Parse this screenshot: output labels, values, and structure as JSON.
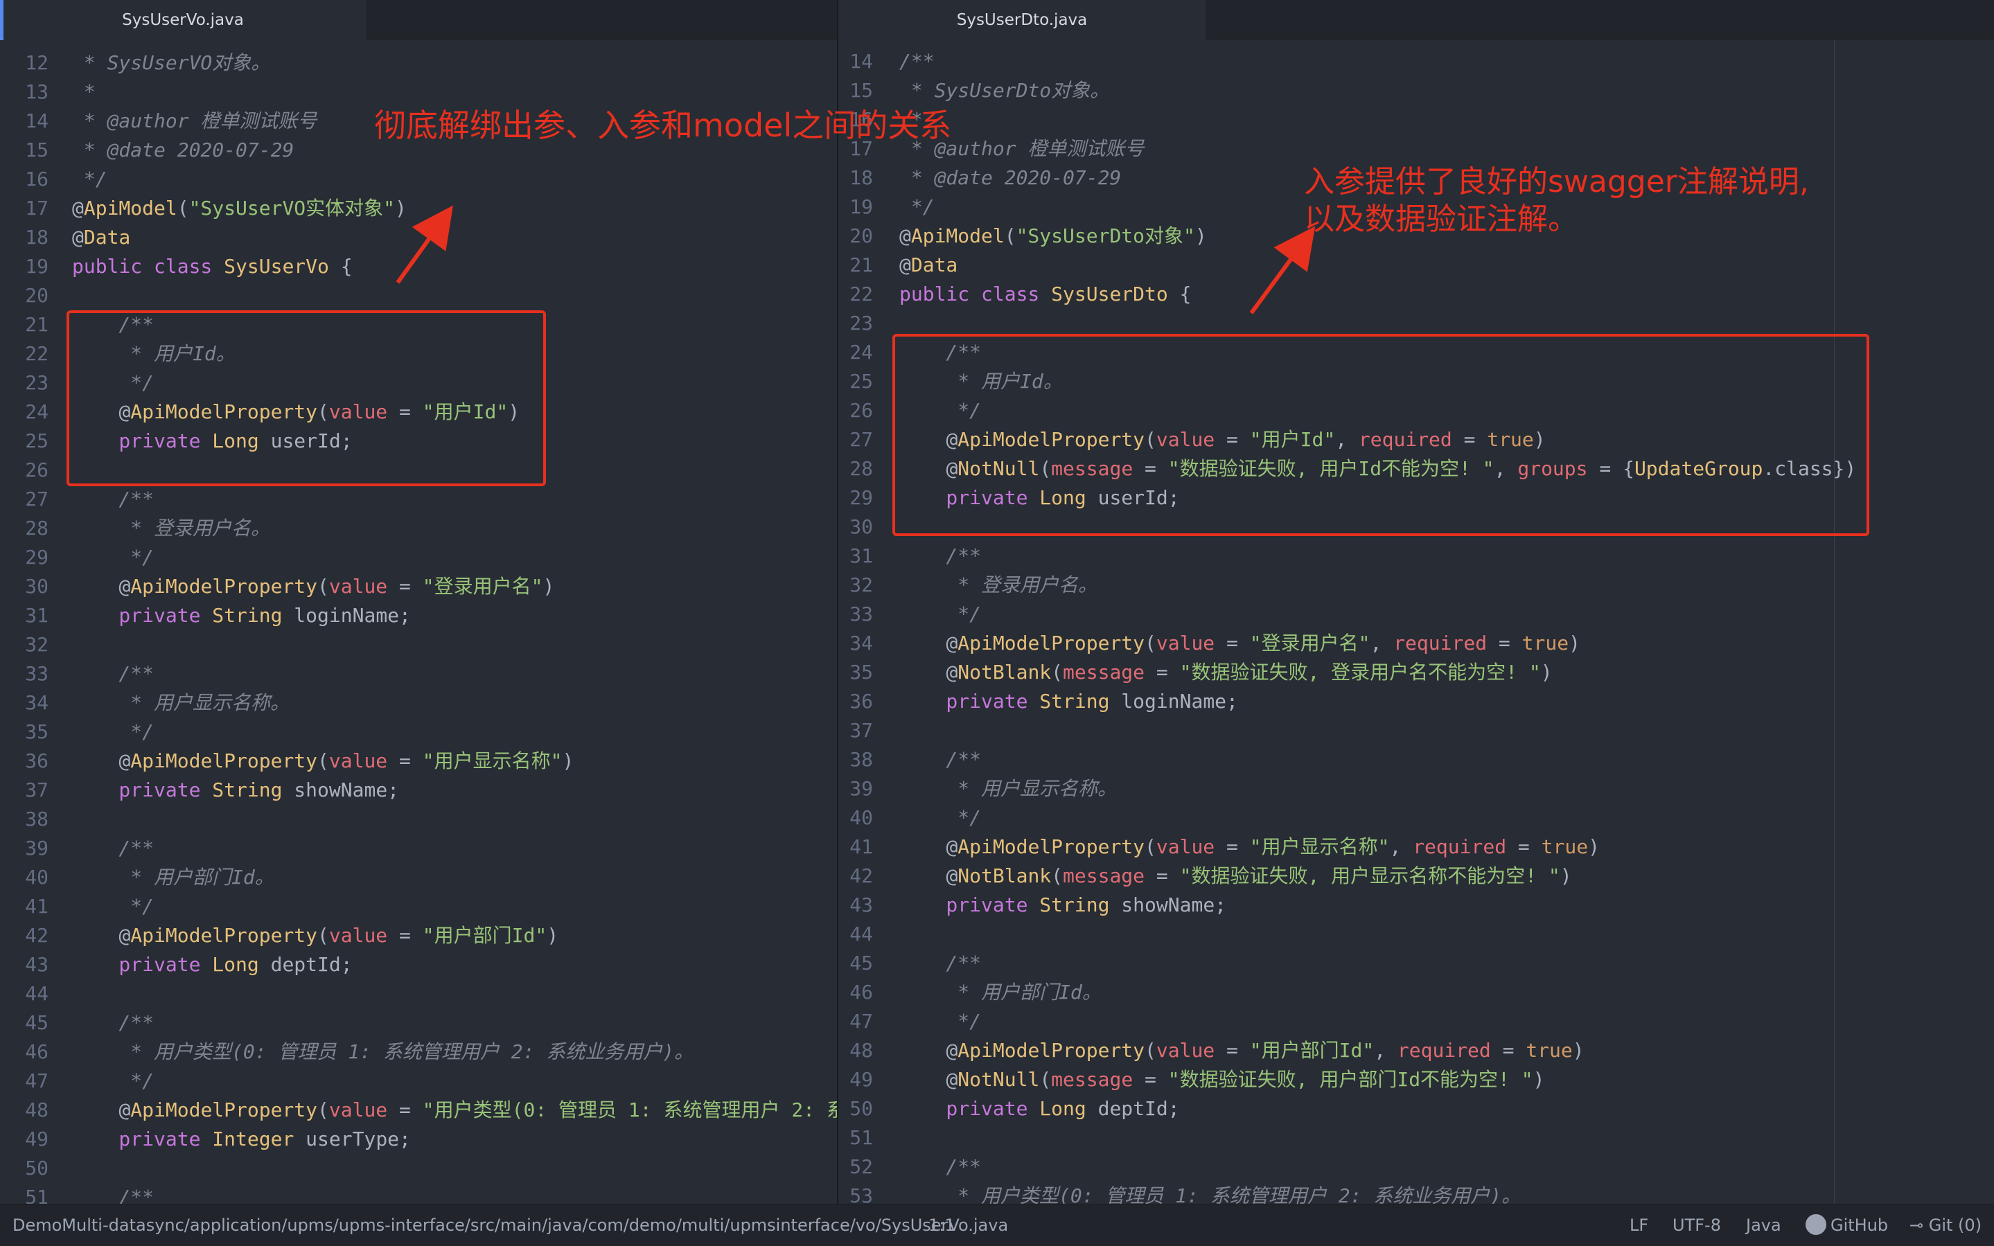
{
  "tabs": {
    "left": "SysUserVo.java",
    "right": "SysUserDto.java"
  },
  "annotations": {
    "left": "彻底解绑出参、入参和model之间的关系",
    "right_line1": "入参提供了良好的swagger注解说明,",
    "right_line2": "以及数据验证注解。"
  },
  "left_code": [
    {
      "n": "12",
      "t": [
        [
          "c",
          " * SysUserVO对象。"
        ]
      ]
    },
    {
      "n": "13",
      "t": [
        [
          "c",
          " *"
        ]
      ]
    },
    {
      "n": "14",
      "t": [
        [
          "c",
          " * @author 橙单测试账号"
        ]
      ]
    },
    {
      "n": "15",
      "t": [
        [
          "c",
          " * @date 2020-07-29"
        ]
      ]
    },
    {
      "n": "16",
      "t": [
        [
          "c",
          " */"
        ]
      ]
    },
    {
      "n": "17",
      "t": [
        [
          "at",
          "@"
        ],
        [
          "an",
          "ApiModel"
        ],
        [
          "txt",
          "("
        ],
        [
          "st",
          "\"SysUserVO实体对象\""
        ],
        [
          "txt",
          ")"
        ]
      ]
    },
    {
      "n": "18",
      "t": [
        [
          "at",
          "@"
        ],
        [
          "an",
          "Data"
        ]
      ]
    },
    {
      "n": "19",
      "t": [
        [
          "kw",
          "public class "
        ],
        [
          "ty",
          "SysUserVo"
        ],
        [
          "txt",
          " {"
        ]
      ]
    },
    {
      "n": "20",
      "t": []
    },
    {
      "n": "21",
      "t": [
        [
          "c",
          "    /**"
        ]
      ]
    },
    {
      "n": "22",
      "t": [
        [
          "c",
          "     * 用户Id。"
        ]
      ]
    },
    {
      "n": "23",
      "t": [
        [
          "c",
          "     */"
        ]
      ]
    },
    {
      "n": "24",
      "t": [
        [
          "txt",
          "    "
        ],
        [
          "at",
          "@"
        ],
        [
          "an",
          "ApiModelProperty"
        ],
        [
          "txt",
          "("
        ],
        [
          "pr",
          "value"
        ],
        [
          "txt",
          " = "
        ],
        [
          "st",
          "\"用户Id\""
        ],
        [
          "txt",
          ")"
        ]
      ]
    },
    {
      "n": "25",
      "t": [
        [
          "kw",
          "    private "
        ],
        [
          "ty",
          "Long"
        ],
        [
          "txt",
          " userId;"
        ]
      ]
    },
    {
      "n": "26",
      "t": []
    },
    {
      "n": "27",
      "t": [
        [
          "c",
          "    /**"
        ]
      ]
    },
    {
      "n": "28",
      "t": [
        [
          "c",
          "     * 登录用户名。"
        ]
      ]
    },
    {
      "n": "29",
      "t": [
        [
          "c",
          "     */"
        ]
      ]
    },
    {
      "n": "30",
      "t": [
        [
          "txt",
          "    "
        ],
        [
          "at",
          "@"
        ],
        [
          "an",
          "ApiModelProperty"
        ],
        [
          "txt",
          "("
        ],
        [
          "pr",
          "value"
        ],
        [
          "txt",
          " = "
        ],
        [
          "st",
          "\"登录用户名\""
        ],
        [
          "txt",
          ")"
        ]
      ]
    },
    {
      "n": "31",
      "t": [
        [
          "kw",
          "    private "
        ],
        [
          "ty",
          "String"
        ],
        [
          "txt",
          " loginName;"
        ]
      ]
    },
    {
      "n": "32",
      "t": []
    },
    {
      "n": "33",
      "t": [
        [
          "c",
          "    /**"
        ]
      ]
    },
    {
      "n": "34",
      "t": [
        [
          "c",
          "     * 用户显示名称。"
        ]
      ]
    },
    {
      "n": "35",
      "t": [
        [
          "c",
          "     */"
        ]
      ]
    },
    {
      "n": "36",
      "t": [
        [
          "txt",
          "    "
        ],
        [
          "at",
          "@"
        ],
        [
          "an",
          "ApiModelProperty"
        ],
        [
          "txt",
          "("
        ],
        [
          "pr",
          "value"
        ],
        [
          "txt",
          " = "
        ],
        [
          "st",
          "\"用户显示名称\""
        ],
        [
          "txt",
          ")"
        ]
      ]
    },
    {
      "n": "37",
      "t": [
        [
          "kw",
          "    private "
        ],
        [
          "ty",
          "String"
        ],
        [
          "txt",
          " showName;"
        ]
      ]
    },
    {
      "n": "38",
      "t": []
    },
    {
      "n": "39",
      "t": [
        [
          "c",
          "    /**"
        ]
      ]
    },
    {
      "n": "40",
      "t": [
        [
          "c",
          "     * 用户部门Id。"
        ]
      ]
    },
    {
      "n": "41",
      "t": [
        [
          "c",
          "     */"
        ]
      ]
    },
    {
      "n": "42",
      "t": [
        [
          "txt",
          "    "
        ],
        [
          "at",
          "@"
        ],
        [
          "an",
          "ApiModelProperty"
        ],
        [
          "txt",
          "("
        ],
        [
          "pr",
          "value"
        ],
        [
          "txt",
          " = "
        ],
        [
          "st",
          "\"用户部门Id\""
        ],
        [
          "txt",
          ")"
        ]
      ]
    },
    {
      "n": "43",
      "t": [
        [
          "kw",
          "    private "
        ],
        [
          "ty",
          "Long"
        ],
        [
          "txt",
          " deptId;"
        ]
      ]
    },
    {
      "n": "44",
      "t": []
    },
    {
      "n": "45",
      "t": [
        [
          "c",
          "    /**"
        ]
      ]
    },
    {
      "n": "46",
      "t": [
        [
          "c",
          "     * 用户类型(0: 管理员 1: 系统管理用户 2: 系统业务用户)。"
        ]
      ]
    },
    {
      "n": "47",
      "t": [
        [
          "c",
          "     */"
        ]
      ]
    },
    {
      "n": "48",
      "t": [
        [
          "txt",
          "    "
        ],
        [
          "at",
          "@"
        ],
        [
          "an",
          "ApiModelProperty"
        ],
        [
          "txt",
          "("
        ],
        [
          "pr",
          "value"
        ],
        [
          "txt",
          " = "
        ],
        [
          "st",
          "\"用户类型(0: 管理员 1: 系统管理用户 2: 系"
        ]
      ]
    },
    {
      "n": "49",
      "t": [
        [
          "kw",
          "    private "
        ],
        [
          "ty",
          "Integer"
        ],
        [
          "txt",
          " userType;"
        ]
      ]
    },
    {
      "n": "50",
      "t": []
    },
    {
      "n": "51",
      "t": [
        [
          "c",
          "    /**"
        ]
      ]
    }
  ],
  "right_code": [
    {
      "n": "14",
      "t": [
        [
          "c",
          "/**"
        ]
      ]
    },
    {
      "n": "15",
      "t": [
        [
          "c",
          " * SysUserDto对象。"
        ]
      ]
    },
    {
      "n": "16",
      "t": [
        [
          "c",
          " *"
        ]
      ]
    },
    {
      "n": "17",
      "t": [
        [
          "c",
          " * @author 橙单测试账号"
        ]
      ]
    },
    {
      "n": "18",
      "t": [
        [
          "c",
          " * @date 2020-07-29"
        ]
      ]
    },
    {
      "n": "19",
      "t": [
        [
          "c",
          " */"
        ]
      ]
    },
    {
      "n": "20",
      "t": [
        [
          "at",
          "@"
        ],
        [
          "an",
          "ApiModel"
        ],
        [
          "txt",
          "("
        ],
        [
          "st",
          "\"SysUserDto对象\""
        ],
        [
          "txt",
          ")"
        ]
      ]
    },
    {
      "n": "21",
      "t": [
        [
          "at",
          "@"
        ],
        [
          "an",
          "Data"
        ]
      ]
    },
    {
      "n": "22",
      "t": [
        [
          "kw",
          "public class "
        ],
        [
          "ty",
          "SysUserDto"
        ],
        [
          "txt",
          " {"
        ]
      ]
    },
    {
      "n": "23",
      "t": []
    },
    {
      "n": "24",
      "t": [
        [
          "c",
          "    /**"
        ]
      ]
    },
    {
      "n": "25",
      "t": [
        [
          "c",
          "     * 用户Id。"
        ]
      ]
    },
    {
      "n": "26",
      "t": [
        [
          "c",
          "     */"
        ]
      ]
    },
    {
      "n": "27",
      "t": [
        [
          "txt",
          "    "
        ],
        [
          "at",
          "@"
        ],
        [
          "an",
          "ApiModelProperty"
        ],
        [
          "txt",
          "("
        ],
        [
          "pr",
          "value"
        ],
        [
          "txt",
          " = "
        ],
        [
          "st",
          "\"用户Id\""
        ],
        [
          "txt",
          ", "
        ],
        [
          "pr",
          "required"
        ],
        [
          "txt",
          " = "
        ],
        [
          "vl",
          "true"
        ],
        [
          "txt",
          ")"
        ]
      ]
    },
    {
      "n": "28",
      "t": [
        [
          "txt",
          "    "
        ],
        [
          "at",
          "@"
        ],
        [
          "an",
          "NotNull"
        ],
        [
          "txt",
          "("
        ],
        [
          "pr",
          "message"
        ],
        [
          "txt",
          " = "
        ],
        [
          "st",
          "\"数据验证失败, 用户Id不能为空! \""
        ],
        [
          "txt",
          ", "
        ],
        [
          "pr",
          "groups"
        ],
        [
          "txt",
          " = {"
        ],
        [
          "ty",
          "UpdateGroup"
        ],
        [
          "txt",
          ".class})"
        ]
      ]
    },
    {
      "n": "29",
      "t": [
        [
          "kw",
          "    private "
        ],
        [
          "ty",
          "Long"
        ],
        [
          "txt",
          " userId;"
        ]
      ]
    },
    {
      "n": "30",
      "t": []
    },
    {
      "n": "31",
      "t": [
        [
          "c",
          "    /**"
        ]
      ]
    },
    {
      "n": "32",
      "t": [
        [
          "c",
          "     * 登录用户名。"
        ]
      ]
    },
    {
      "n": "33",
      "t": [
        [
          "c",
          "     */"
        ]
      ]
    },
    {
      "n": "34",
      "t": [
        [
          "txt",
          "    "
        ],
        [
          "at",
          "@"
        ],
        [
          "an",
          "ApiModelProperty"
        ],
        [
          "txt",
          "("
        ],
        [
          "pr",
          "value"
        ],
        [
          "txt",
          " = "
        ],
        [
          "st",
          "\"登录用户名\""
        ],
        [
          "txt",
          ", "
        ],
        [
          "pr",
          "required"
        ],
        [
          "txt",
          " = "
        ],
        [
          "vl",
          "true"
        ],
        [
          "txt",
          ")"
        ]
      ]
    },
    {
      "n": "35",
      "t": [
        [
          "txt",
          "    "
        ],
        [
          "at",
          "@"
        ],
        [
          "an",
          "NotBlank"
        ],
        [
          "txt",
          "("
        ],
        [
          "pr",
          "message"
        ],
        [
          "txt",
          " = "
        ],
        [
          "st",
          "\"数据验证失败, 登录用户名不能为空! \""
        ],
        [
          "txt",
          ")"
        ]
      ]
    },
    {
      "n": "36",
      "t": [
        [
          "kw",
          "    private "
        ],
        [
          "ty",
          "String"
        ],
        [
          "txt",
          " loginName;"
        ]
      ]
    },
    {
      "n": "37",
      "t": []
    },
    {
      "n": "38",
      "t": [
        [
          "c",
          "    /**"
        ]
      ]
    },
    {
      "n": "39",
      "t": [
        [
          "c",
          "     * 用户显示名称。"
        ]
      ]
    },
    {
      "n": "40",
      "t": [
        [
          "c",
          "     */"
        ]
      ]
    },
    {
      "n": "41",
      "t": [
        [
          "txt",
          "    "
        ],
        [
          "at",
          "@"
        ],
        [
          "an",
          "ApiModelProperty"
        ],
        [
          "txt",
          "("
        ],
        [
          "pr",
          "value"
        ],
        [
          "txt",
          " = "
        ],
        [
          "st",
          "\"用户显示名称\""
        ],
        [
          "txt",
          ", "
        ],
        [
          "pr",
          "required"
        ],
        [
          "txt",
          " = "
        ],
        [
          "vl",
          "true"
        ],
        [
          "txt",
          ")"
        ]
      ]
    },
    {
      "n": "42",
      "t": [
        [
          "txt",
          "    "
        ],
        [
          "at",
          "@"
        ],
        [
          "an",
          "NotBlank"
        ],
        [
          "txt",
          "("
        ],
        [
          "pr",
          "message"
        ],
        [
          "txt",
          " = "
        ],
        [
          "st",
          "\"数据验证失败, 用户显示名称不能为空! \""
        ],
        [
          "txt",
          ")"
        ]
      ]
    },
    {
      "n": "43",
      "t": [
        [
          "kw",
          "    private "
        ],
        [
          "ty",
          "String"
        ],
        [
          "txt",
          " showName;"
        ]
      ]
    },
    {
      "n": "44",
      "t": []
    },
    {
      "n": "45",
      "t": [
        [
          "c",
          "    /**"
        ]
      ]
    },
    {
      "n": "46",
      "t": [
        [
          "c",
          "     * 用户部门Id。"
        ]
      ]
    },
    {
      "n": "47",
      "t": [
        [
          "c",
          "     */"
        ]
      ]
    },
    {
      "n": "48",
      "t": [
        [
          "txt",
          "    "
        ],
        [
          "at",
          "@"
        ],
        [
          "an",
          "ApiModelProperty"
        ],
        [
          "txt",
          "("
        ],
        [
          "pr",
          "value"
        ],
        [
          "txt",
          " = "
        ],
        [
          "st",
          "\"用户部门Id\""
        ],
        [
          "txt",
          ", "
        ],
        [
          "pr",
          "required"
        ],
        [
          "txt",
          " = "
        ],
        [
          "vl",
          "true"
        ],
        [
          "txt",
          ")"
        ]
      ]
    },
    {
      "n": "49",
      "t": [
        [
          "txt",
          "    "
        ],
        [
          "at",
          "@"
        ],
        [
          "an",
          "NotNull"
        ],
        [
          "txt",
          "("
        ],
        [
          "pr",
          "message"
        ],
        [
          "txt",
          " = "
        ],
        [
          "st",
          "\"数据验证失败, 用户部门Id不能为空! \""
        ],
        [
          "txt",
          ")"
        ]
      ]
    },
    {
      "n": "50",
      "t": [
        [
          "kw",
          "    private "
        ],
        [
          "ty",
          "Long"
        ],
        [
          "txt",
          " deptId;"
        ]
      ]
    },
    {
      "n": "51",
      "t": []
    },
    {
      "n": "52",
      "t": [
        [
          "c",
          "    /**"
        ]
      ]
    },
    {
      "n": "53",
      "t": [
        [
          "c",
          "     * 用户类型(0: 管理员 1: 系统管理用户 2: 系统业务用户)。"
        ]
      ]
    }
  ],
  "status": {
    "path": "DemoMulti-datasync/application/upms/upms-interface/src/main/java/com/demo/multi/upmsinterface/vo/SysUserVo.java",
    "cursor": "1:1",
    "line_ending": "LF",
    "encoding": "UTF-8",
    "grammar": "Java",
    "github": "GitHub",
    "git": "Git (0)"
  },
  "colors": {
    "annotation": "#e8301f",
    "background": "#282c34"
  }
}
